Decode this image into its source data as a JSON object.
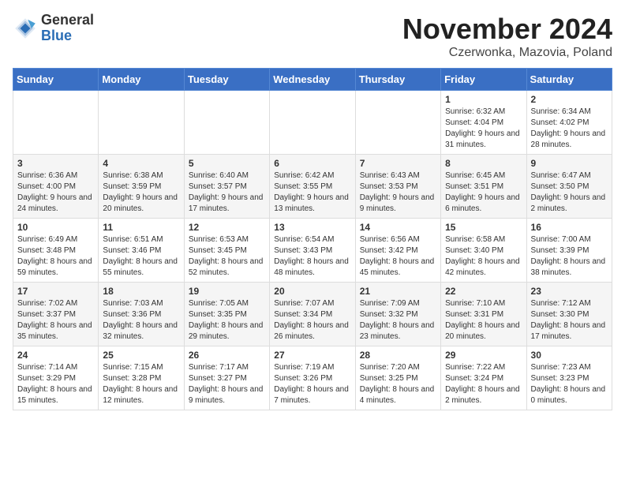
{
  "header": {
    "logo_general": "General",
    "logo_blue": "Blue",
    "month_title": "November 2024",
    "location": "Czerwonka, Mazovia, Poland"
  },
  "columns": [
    "Sunday",
    "Monday",
    "Tuesday",
    "Wednesday",
    "Thursday",
    "Friday",
    "Saturday"
  ],
  "weeks": [
    {
      "days": [
        {
          "num": "",
          "info": ""
        },
        {
          "num": "",
          "info": ""
        },
        {
          "num": "",
          "info": ""
        },
        {
          "num": "",
          "info": ""
        },
        {
          "num": "",
          "info": ""
        },
        {
          "num": "1",
          "info": "Sunrise: 6:32 AM\nSunset: 4:04 PM\nDaylight: 9 hours and 31 minutes."
        },
        {
          "num": "2",
          "info": "Sunrise: 6:34 AM\nSunset: 4:02 PM\nDaylight: 9 hours and 28 minutes."
        }
      ]
    },
    {
      "days": [
        {
          "num": "3",
          "info": "Sunrise: 6:36 AM\nSunset: 4:00 PM\nDaylight: 9 hours and 24 minutes."
        },
        {
          "num": "4",
          "info": "Sunrise: 6:38 AM\nSunset: 3:59 PM\nDaylight: 9 hours and 20 minutes."
        },
        {
          "num": "5",
          "info": "Sunrise: 6:40 AM\nSunset: 3:57 PM\nDaylight: 9 hours and 17 minutes."
        },
        {
          "num": "6",
          "info": "Sunrise: 6:42 AM\nSunset: 3:55 PM\nDaylight: 9 hours and 13 minutes."
        },
        {
          "num": "7",
          "info": "Sunrise: 6:43 AM\nSunset: 3:53 PM\nDaylight: 9 hours and 9 minutes."
        },
        {
          "num": "8",
          "info": "Sunrise: 6:45 AM\nSunset: 3:51 PM\nDaylight: 9 hours and 6 minutes."
        },
        {
          "num": "9",
          "info": "Sunrise: 6:47 AM\nSunset: 3:50 PM\nDaylight: 9 hours and 2 minutes."
        }
      ]
    },
    {
      "days": [
        {
          "num": "10",
          "info": "Sunrise: 6:49 AM\nSunset: 3:48 PM\nDaylight: 8 hours and 59 minutes."
        },
        {
          "num": "11",
          "info": "Sunrise: 6:51 AM\nSunset: 3:46 PM\nDaylight: 8 hours and 55 minutes."
        },
        {
          "num": "12",
          "info": "Sunrise: 6:53 AM\nSunset: 3:45 PM\nDaylight: 8 hours and 52 minutes."
        },
        {
          "num": "13",
          "info": "Sunrise: 6:54 AM\nSunset: 3:43 PM\nDaylight: 8 hours and 48 minutes."
        },
        {
          "num": "14",
          "info": "Sunrise: 6:56 AM\nSunset: 3:42 PM\nDaylight: 8 hours and 45 minutes."
        },
        {
          "num": "15",
          "info": "Sunrise: 6:58 AM\nSunset: 3:40 PM\nDaylight: 8 hours and 42 minutes."
        },
        {
          "num": "16",
          "info": "Sunrise: 7:00 AM\nSunset: 3:39 PM\nDaylight: 8 hours and 38 minutes."
        }
      ]
    },
    {
      "days": [
        {
          "num": "17",
          "info": "Sunrise: 7:02 AM\nSunset: 3:37 PM\nDaylight: 8 hours and 35 minutes."
        },
        {
          "num": "18",
          "info": "Sunrise: 7:03 AM\nSunset: 3:36 PM\nDaylight: 8 hours and 32 minutes."
        },
        {
          "num": "19",
          "info": "Sunrise: 7:05 AM\nSunset: 3:35 PM\nDaylight: 8 hours and 29 minutes."
        },
        {
          "num": "20",
          "info": "Sunrise: 7:07 AM\nSunset: 3:34 PM\nDaylight: 8 hours and 26 minutes."
        },
        {
          "num": "21",
          "info": "Sunrise: 7:09 AM\nSunset: 3:32 PM\nDaylight: 8 hours and 23 minutes."
        },
        {
          "num": "22",
          "info": "Sunrise: 7:10 AM\nSunset: 3:31 PM\nDaylight: 8 hours and 20 minutes."
        },
        {
          "num": "23",
          "info": "Sunrise: 7:12 AM\nSunset: 3:30 PM\nDaylight: 8 hours and 17 minutes."
        }
      ]
    },
    {
      "days": [
        {
          "num": "24",
          "info": "Sunrise: 7:14 AM\nSunset: 3:29 PM\nDaylight: 8 hours and 15 minutes."
        },
        {
          "num": "25",
          "info": "Sunrise: 7:15 AM\nSunset: 3:28 PM\nDaylight: 8 hours and 12 minutes."
        },
        {
          "num": "26",
          "info": "Sunrise: 7:17 AM\nSunset: 3:27 PM\nDaylight: 8 hours and 9 minutes."
        },
        {
          "num": "27",
          "info": "Sunrise: 7:19 AM\nSunset: 3:26 PM\nDaylight: 8 hours and 7 minutes."
        },
        {
          "num": "28",
          "info": "Sunrise: 7:20 AM\nSunset: 3:25 PM\nDaylight: 8 hours and 4 minutes."
        },
        {
          "num": "29",
          "info": "Sunrise: 7:22 AM\nSunset: 3:24 PM\nDaylight: 8 hours and 2 minutes."
        },
        {
          "num": "30",
          "info": "Sunrise: 7:23 AM\nSunset: 3:23 PM\nDaylight: 8 hours and 0 minutes."
        }
      ]
    }
  ]
}
